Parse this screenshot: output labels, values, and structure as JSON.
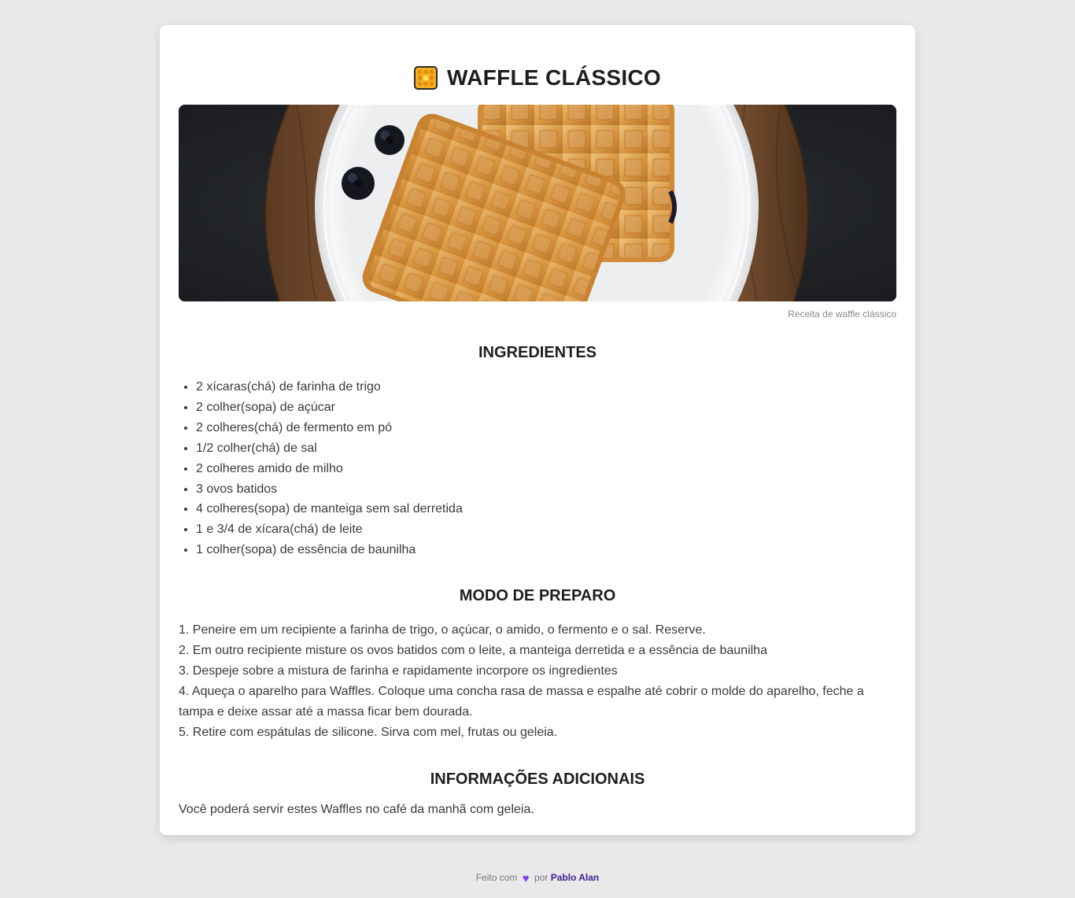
{
  "recipe": {
    "title": "WAFFLE CLÁSSICO",
    "image_caption": "Receita de waffle clássico"
  },
  "ingredients": {
    "heading": "INGREDIENTES",
    "items": [
      "2 xícaras(chá) de farinha de trigo",
      "2 colher(sopa) de açúcar",
      "2 colheres(chá) de fermento em pó",
      "1/2 colher(chá) de sal",
      "2 colheres amido de milho",
      "3 ovos batidos",
      "4 colheres(sopa) de manteiga sem sal derretida",
      "1 e 3/4 de xícara(chá) de leite",
      "1 colher(sopa) de essência de baunilha"
    ]
  },
  "preparation": {
    "heading": "MODO DE PREPARO",
    "steps": [
      "1. Peneire em um recipiente a farinha de trigo, o açúcar, o amido, o fermento e o sal. Reserve.",
      "2. Em outro recipiente misture os ovos batidos com o leite, a manteiga derretida e a essência de baunilha",
      "3. Despeje sobre a mistura de farinha e rapidamente incorpore os ingredientes",
      "4. Aqueça o aparelho para Waffles. Coloque uma concha rasa de massa e espalhe até cobrir o molde do aparelho, feche a tampa e deixe assar até a massa ficar bem dourada.",
      "5. Retire com espátulas de silicone. Sirva com mel, frutas ou geleia."
    ]
  },
  "additional": {
    "heading": "INFORMAÇÕES ADICIONAIS",
    "text": "Você poderá servir estes Waffles no café da manhã com geleia."
  },
  "footer": {
    "made_with": "Feito com",
    "by": "por",
    "author": "Pablo Alan"
  },
  "icons": {
    "title_icon": "waffle-icon",
    "footer_icon": "purple-heart-icon"
  },
  "colors": {
    "page_bg": "#e9e9e9",
    "card_bg": "#ffffff",
    "heart": "#7b43e6",
    "author_link": "#3d1f8c"
  }
}
